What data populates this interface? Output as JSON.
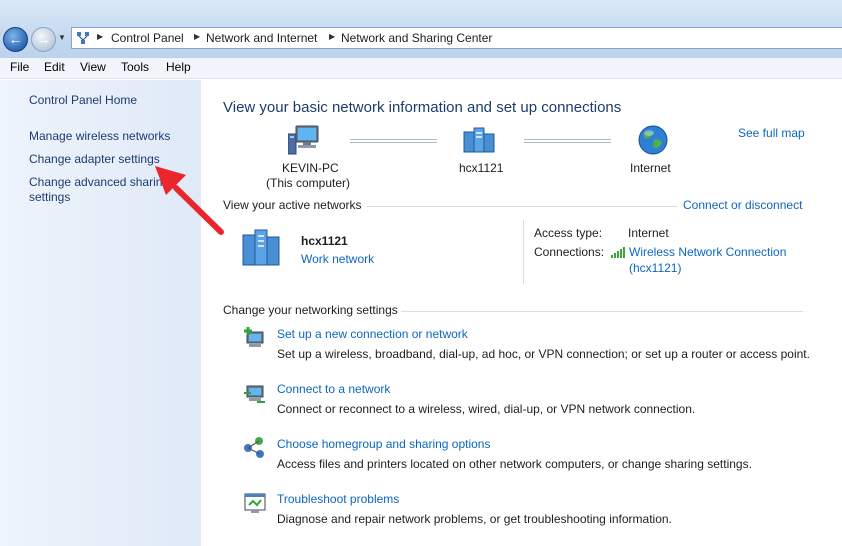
{
  "address_bar": {
    "breadcrumbs": [
      "Control Panel",
      "Network and Internet",
      "Network and Sharing Center"
    ]
  },
  "menu": [
    "File",
    "Edit",
    "View",
    "Tools",
    "Help"
  ],
  "sidebar": {
    "home": "Control Panel Home",
    "items": [
      "Manage wireless networks",
      "Change adapter settings",
      "Change advanced sharing",
      "settings"
    ]
  },
  "main": {
    "title": "View your basic network information and set up connections",
    "see_full_map": "See full map",
    "map": {
      "computer_name": "KEVIN-PC",
      "computer_sub": "(This computer)",
      "network_name": "hcx1121",
      "internet": "Internet"
    },
    "active_networks": {
      "heading": "View your active networks",
      "connect_link": "Connect or disconnect",
      "network_name": "hcx1121",
      "network_type": "Work network",
      "access_type_label": "Access type:",
      "access_type_value": "Internet",
      "connections_label": "Connections:",
      "connection_line1": "Wireless Network Connection",
      "connection_line2": "(hcx1121)"
    },
    "settings": {
      "heading": "Change your networking settings",
      "tasks": [
        {
          "title": "Set up a new connection or network",
          "desc": "Set up a wireless, broadband, dial-up, ad hoc, or VPN connection; or set up a router or access point."
        },
        {
          "title": "Connect to a network",
          "desc": "Connect or reconnect to a wireless, wired, dial-up, or VPN network connection."
        },
        {
          "title": "Choose homegroup and sharing options",
          "desc": "Access files and printers located on other network computers, or change sharing settings."
        },
        {
          "title": "Troubleshoot problems",
          "desc": "Diagnose and repair network problems, or get troubleshooting information."
        }
      ]
    }
  },
  "colors": {
    "link": "#0c66c1",
    "heading": "#1e3b70",
    "annotation_arrow": "#e8262b"
  }
}
